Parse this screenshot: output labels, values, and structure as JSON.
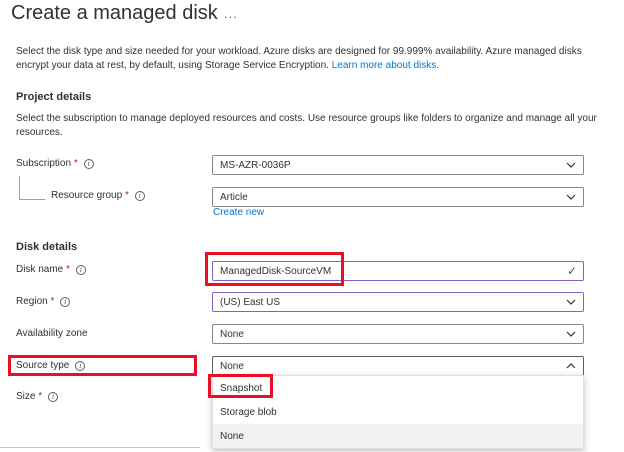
{
  "header": {
    "title": "Create a managed disk",
    "more_label": "..."
  },
  "intro": {
    "text": "Select the disk type and size needed for your workload. Azure disks are designed for 99.999% availability. Azure managed disks encrypt your data at rest, by default, using Storage Service Encryption.",
    "link": "Learn more about disks."
  },
  "project": {
    "heading": "Project details",
    "description": "Select the subscription to manage deployed resources and costs. Use resource groups like folders to organize and manage all your resources.",
    "subscription_label": "Subscription",
    "subscription_value": "MS-AZR-0036P",
    "resource_group_label": "Resource group",
    "resource_group_value": "Article",
    "create_new": "Create new"
  },
  "disk": {
    "heading": "Disk details",
    "name_label": "Disk name",
    "name_value": "ManagedDisk-SourceVM",
    "region_label": "Region",
    "region_value": "(US) East US",
    "zone_label": "Availability zone",
    "zone_value": "None",
    "source_label": "Source type",
    "source_value": "None",
    "size_label": "Size",
    "source_options": [
      "Snapshot",
      "Storage blob",
      "None"
    ]
  },
  "common": {
    "required_mark": "*",
    "info_glyph": "i",
    "check_glyph": "✓"
  },
  "colors": {
    "accent": "#0078d4",
    "required": "#a4262c",
    "highlight": "#e81123",
    "valid": "#107c10"
  }
}
